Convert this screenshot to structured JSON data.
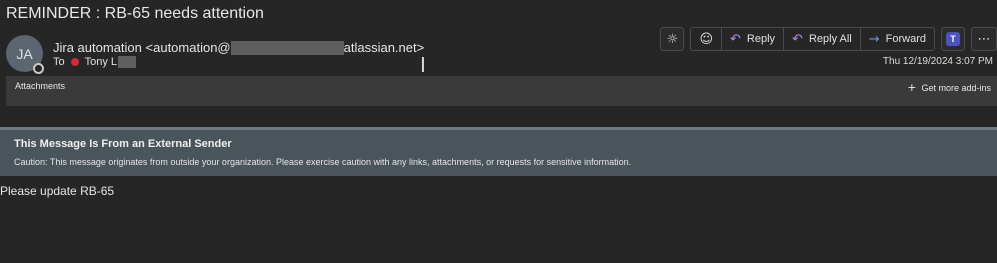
{
  "subject": "REMINDER : RB-65 needs attention",
  "sender": {
    "initials": "JA",
    "name": "Jira automation",
    "email_prefix": "<automation@",
    "email_suffix": "atlassian.net>"
  },
  "recipient": {
    "to_label": "To",
    "name": "Tony L"
  },
  "toolbar": {
    "brightness_icon": "sun-icon",
    "emoji_icon": "smiley-icon",
    "reply_label": "Reply",
    "reply_all_label": "Reply All",
    "forward_label": "Forward",
    "teams_badge": "T",
    "more_glyph": "⋯"
  },
  "timestamp": "Thu 12/19/2024 3:07 PM",
  "attachments": {
    "label": "Attachments",
    "addins_label": "Get more add-ins"
  },
  "external_banner": {
    "title": "This Message Is From an External Sender",
    "text": "Caution: This message originates from outside your organization. Please exercise caution with any links, attachments, or requests for sensitive information."
  },
  "body": {
    "text": "Please update RB-65"
  },
  "colors": {
    "background": "#262626",
    "attachments_bar": "#3a3a3a",
    "banner": "#4a545b",
    "reply_accent": "#b48ee6",
    "forward_accent": "#5aa0e8",
    "presence_red": "#d7263d"
  }
}
